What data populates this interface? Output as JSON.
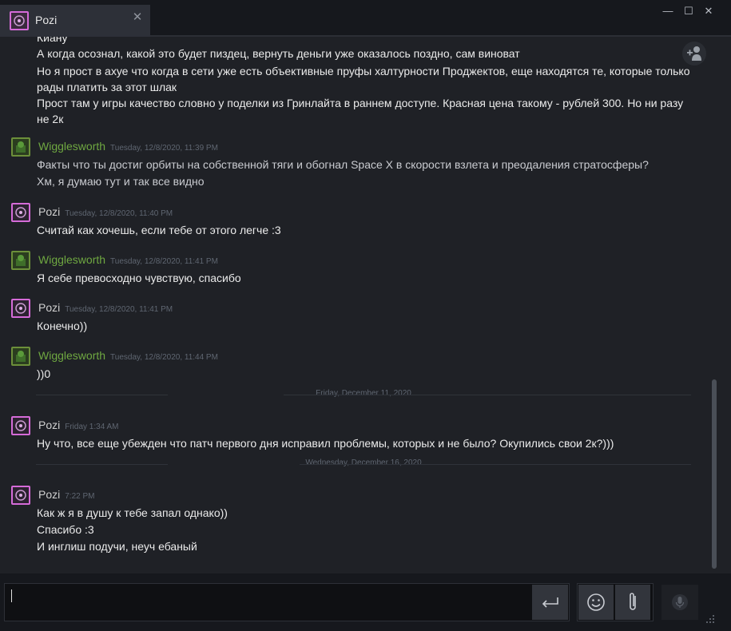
{
  "tab": {
    "title": "Pozi",
    "close": "✕"
  },
  "window": {
    "minimize": "—",
    "maximize": "☐",
    "close": "✕"
  },
  "messages": {
    "m0": {
      "sender_partial": "Киану",
      "lines": [
        "А когда осознал, какой это будет пиздец, вернуть деньги уже оказалось поздно, сам виноват",
        "Но я прост в ахуе что когда в сети уже есть объективные пруфы халтурности Проджектов, еще находятся те, которые только рады платить за этот шлак",
        "Прост там у игры качество словно у поделки из Гринлайта в раннем доступе. Красная цена такому - рублей 300. Но ни разу не 2к"
      ]
    },
    "m1": {
      "sender": "Wigglesworth",
      "timestamp": "Tuesday, 12/8/2020, 11:39 PM",
      "lines": [
        "Факты что ты достиг орбиты на собственной тяги и обогнал Space X в скорости взлета и преодаления стратосферы?",
        "Хм, я думаю тут и так все видно"
      ]
    },
    "m2": {
      "sender": "Pozi",
      "timestamp": "Tuesday, 12/8/2020, 11:40 PM",
      "lines": [
        "Считай как хочешь, если тебе от этого легче :3"
      ]
    },
    "m3": {
      "sender": "Wigglesworth",
      "timestamp": "Tuesday, 12/8/2020, 11:41 PM",
      "lines": [
        "Я себе превосходно чувствую, спасибо"
      ]
    },
    "m4": {
      "sender": "Pozi",
      "timestamp": "Tuesday, 12/8/2020, 11:41 PM",
      "lines": [
        "Конечно))"
      ]
    },
    "m5": {
      "sender": "Wigglesworth",
      "timestamp": "Tuesday, 12/8/2020, 11:44 PM",
      "lines": [
        "))0"
      ]
    },
    "sep1": "Friday, December 11, 2020",
    "m6": {
      "sender": "Pozi",
      "timestamp": "Friday 1:34 AM",
      "lines": [
        "Ну что, все еще убежден что патч первого дня исправил проблемы, которых и не было? Окупились свои 2к?)))"
      ]
    },
    "sep2": "Wednesday, December 16, 2020",
    "m7": {
      "sender": "Pozi",
      "timestamp": "7:22 PM",
      "lines": [
        "Как ж я в душу к тебе запал однако))",
        "Спасибо :3",
        "И инглиш подучи, неуч ебаный"
      ]
    }
  },
  "input": {
    "value": ""
  },
  "colors": {
    "pozi_accent": "#d56bd8",
    "wiggle_accent": "#6fa841",
    "background": "#1f2126"
  }
}
